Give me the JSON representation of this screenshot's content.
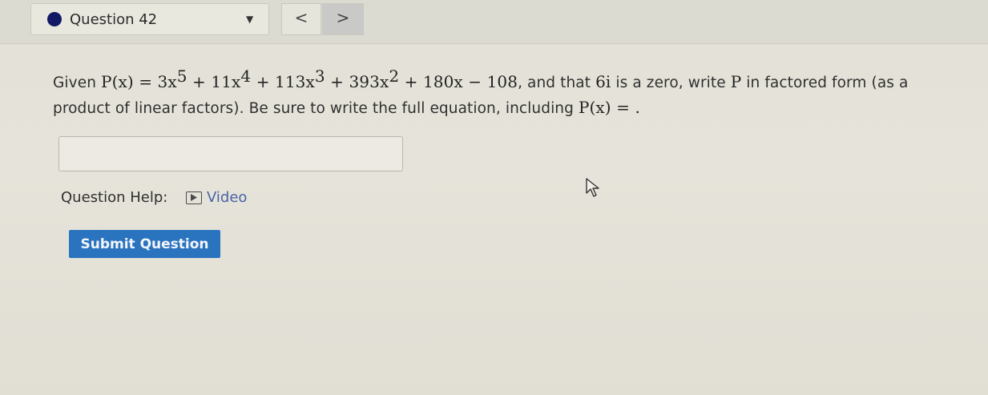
{
  "header": {
    "question_label": "Question 42",
    "caret_glyph": "▼",
    "prev_glyph": "<",
    "next_glyph": ">"
  },
  "problem": {
    "intro": "Given ",
    "fx": "P(x)",
    "equals": " = ",
    "t1": "3x",
    "e1": "5",
    "p1": " + ",
    "t2": "11x",
    "e2": "4",
    "p2": " + ",
    "t3": "113x",
    "e3": "3",
    "p3": " + ",
    "t4": "393x",
    "e4": "2",
    "p4": " + ",
    "t5": "180x",
    "m5": " − ",
    "t6": "108",
    "mid": ", and that ",
    "zero": "6i",
    "mid2": " is a zero, write ",
    "pvar": "P",
    "mid3": " in factored form (as a product of linear factors). Be sure to write the full equation, including ",
    "fx2": "P(x)",
    "end": " = ."
  },
  "answer": {
    "value": ""
  },
  "help": {
    "label": "Question Help:",
    "video_label": "Video"
  },
  "submit": {
    "label": "Submit Question"
  },
  "colors": {
    "accent": "#2a73bf",
    "link": "#4a63a7",
    "dot": "#121a66"
  }
}
